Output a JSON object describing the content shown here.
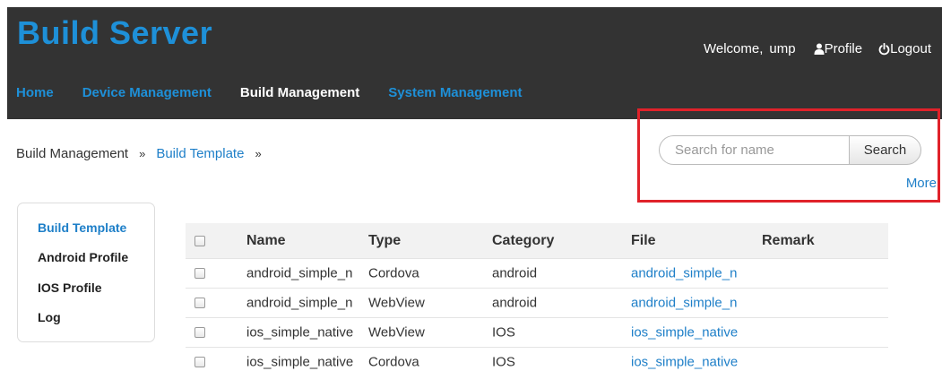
{
  "header": {
    "brand": "Build Server",
    "welcome": "Welcome,",
    "username": "ump",
    "profile_label": "Profile",
    "logout_label": "Logout"
  },
  "nav": {
    "items": [
      {
        "label": "Home",
        "active": false
      },
      {
        "label": "Device Management",
        "active": false
      },
      {
        "label": "Build Management",
        "active": true
      },
      {
        "label": "System Management",
        "active": false
      }
    ]
  },
  "breadcrumb": {
    "items": [
      "Build Management",
      "Build Template"
    ],
    "separator": "»"
  },
  "search": {
    "placeholder": "Search for name",
    "value": "",
    "button_label": "Search",
    "more_label": "More"
  },
  "side_menu": {
    "items": [
      "Build Template",
      "Android Profile",
      "IOS Profile",
      "Log"
    ],
    "active": "Build Template"
  },
  "table": {
    "columns": [
      "Name",
      "Type",
      "Category",
      "File",
      "Remark"
    ],
    "rows": [
      {
        "name": "android_simple_n",
        "type": "Cordova",
        "category": "android",
        "file": "android_simple_n",
        "remark": ""
      },
      {
        "name": "android_simple_n",
        "type": "WebView",
        "category": "android",
        "file": "android_simple_n",
        "remark": ""
      },
      {
        "name": "ios_simple_native",
        "type": "WebView",
        "category": "IOS",
        "file": "ios_simple_native",
        "remark": ""
      },
      {
        "name": "ios_simple_native",
        "type": "Cordova",
        "category": "IOS",
        "file": "ios_simple_native",
        "remark": ""
      }
    ]
  },
  "colors": {
    "header_bg": "#333333",
    "brand": "#1e90d8",
    "link": "#1e7fc8",
    "highlight": "#e0222a"
  },
  "icons": {
    "profile": "user-icon",
    "logout": "power-icon"
  }
}
